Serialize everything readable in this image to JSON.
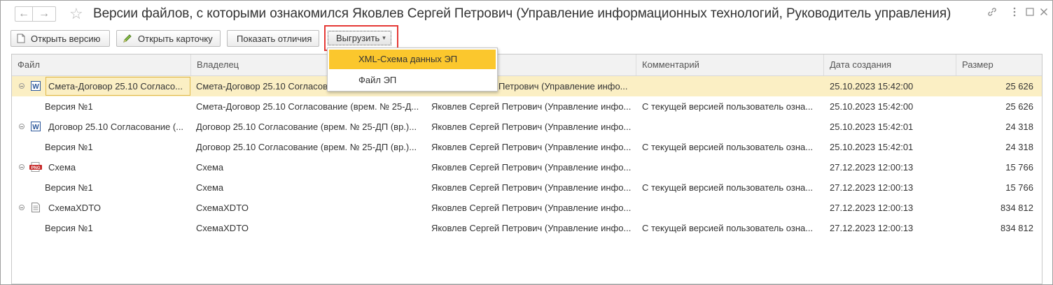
{
  "window": {
    "title": "Версии файлов, с которыми ознакомился Яковлев Сергей Петрович (Управление информационных технологий, Руководитель управления)",
    "back_glyph": "←",
    "forward_glyph": "→",
    "star_glyph": "☆",
    "link_glyph": "🔗",
    "menu_glyph": "⋮",
    "restore_glyph": "□",
    "close_glyph": "×"
  },
  "toolbar": {
    "open_version": "Открыть версию",
    "open_card": "Открыть карточку",
    "show_diff": "Показать отличия",
    "export": "Выгрузить",
    "export_arrow": "▾"
  },
  "export_menu": {
    "items": [
      "XML-Схема данных ЭП",
      "Файл ЭП"
    ],
    "active_index": 0
  },
  "table": {
    "columns": [
      "Файл",
      "Владелец",
      "",
      "Комментарий",
      "Дата создания",
      "Размер"
    ],
    "rows": [
      {
        "file": "Смета-Договор 25.10 Согласо...",
        "owner": "Смета-Договор 25.10 Согласова",
        "author": "Петрович (Управление инфо...",
        "comment": "",
        "date": "25.10.2023 15:42:00",
        "size": "25 626"
      },
      {
        "file": "Версия №1",
        "owner": "Смета-Договор 25.10 Согласование (врем. № 25-Д...",
        "author": "Яковлев Сергей Петрович (Управление инфо...",
        "comment": "С текущей версией пользователь озна...",
        "date": "25.10.2023 15:42:00",
        "size": "25 626"
      },
      {
        "file": "Договор 25.10 Согласование (...",
        "owner": "Договор 25.10 Согласование (врем. № 25-ДП (вр.)...",
        "author": "Яковлев Сергей Петрович (Управление инфо...",
        "comment": "",
        "date": "25.10.2023 15:42:01",
        "size": "24 318"
      },
      {
        "file": "Версия №1",
        "owner": "Договор 25.10 Согласование (врем. № 25-ДП (вр.)...",
        "author": "Яковлев Сергей Петрович (Управление инфо...",
        "comment": "С текущей версией пользователь озна...",
        "date": "25.10.2023 15:42:01",
        "size": "24 318"
      },
      {
        "file": "Схема",
        "owner": "Схема",
        "author": "Яковлев Сергей Петрович (Управление инфо...",
        "comment": "",
        "date": "27.12.2023 12:00:13",
        "size": "15 766"
      },
      {
        "file": "Версия №1",
        "owner": "Схема",
        "author": "Яковлев Сергей Петрович (Управление инфо...",
        "comment": "С текущей версией пользователь озна...",
        "date": "27.12.2023 12:00:13",
        "size": "15 766"
      },
      {
        "file": "СхемаXDTO",
        "owner": "СхемаXDTO",
        "author": "Яковлев Сергей Петрович (Управление инфо...",
        "comment": "",
        "date": "27.12.2023 12:00:13",
        "size": "834 812"
      },
      {
        "file": "Версия №1",
        "owner": "СхемаXDTO",
        "author": "Яковлев Сергей Петрович (Управление инфо...",
        "comment": "С текущей версией пользователь озна...",
        "date": "27.12.2023 12:00:13",
        "size": "834 812"
      }
    ],
    "icons": {
      "word": "W",
      "png": "PNG"
    }
  },
  "colors": {
    "selection": "#fbefc4",
    "menu_active": "#fbc72d",
    "highlight": "#e53935",
    "word_blue": "#2b579a",
    "png_red": "#c62828"
  }
}
